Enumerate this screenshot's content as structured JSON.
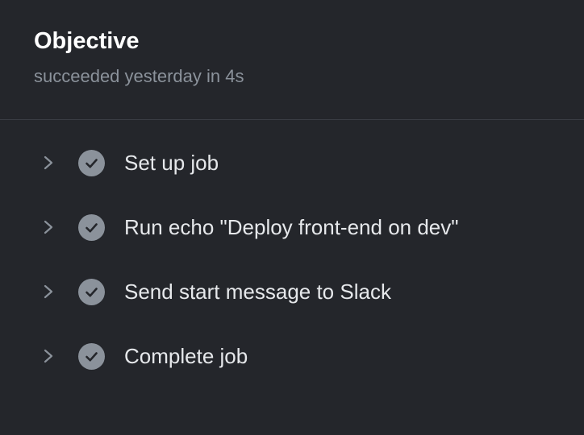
{
  "job": {
    "title": "Objective",
    "status_text": "succeeded yesterday in 4s"
  },
  "steps": [
    {
      "label": "Set up job",
      "status": "success",
      "icon": "check-circle-icon"
    },
    {
      "label": "Run echo \"Deploy front-end on dev\"",
      "status": "success",
      "icon": "check-circle-icon"
    },
    {
      "label": "Send start message to Slack",
      "status": "success",
      "icon": "check-circle-icon"
    },
    {
      "label": "Complete job",
      "status": "success",
      "icon": "check-circle-icon"
    }
  ],
  "colors": {
    "background": "#24262b",
    "title": "#ffffff",
    "muted": "#8b929b",
    "text": "#e6e8eb",
    "divider": "#3a3d44"
  }
}
